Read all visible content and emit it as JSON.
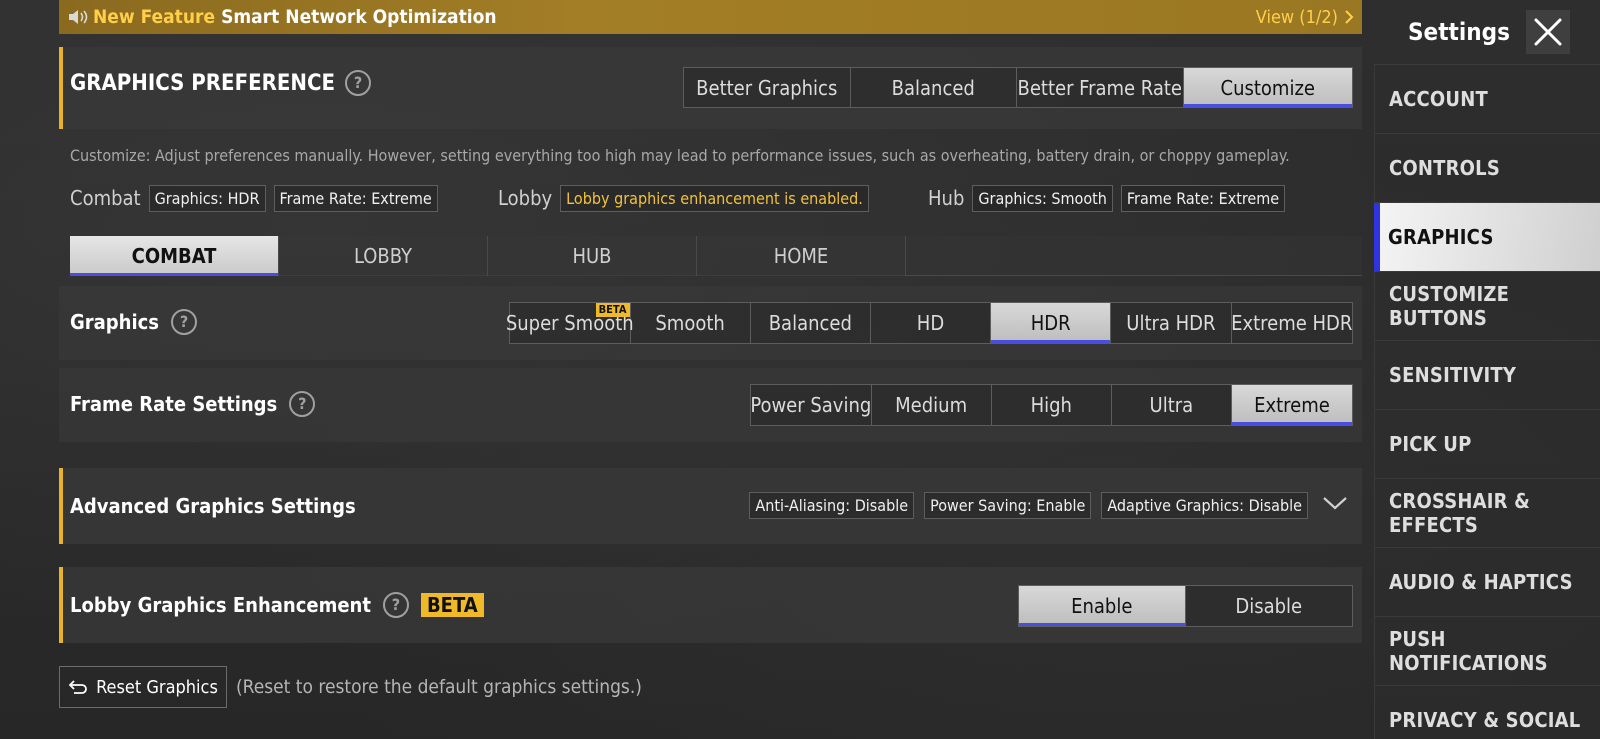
{
  "banner": {
    "new_feature": "New Feature",
    "title": "Smart Network Optimization",
    "view": "View (1/2)"
  },
  "preference": {
    "title": "GRAPHICS PREFERENCE",
    "options": [
      "Better Graphics",
      "Balanced",
      "Better Frame Rate",
      "Customize"
    ],
    "selected": "Customize",
    "description": "Customize: Adjust preferences manually. However, setting everything too high may lead to performance issues, such as overheating, battery drain, or choppy gameplay."
  },
  "summary": {
    "combat_label": "Combat",
    "combat_graphics": "Graphics: HDR",
    "combat_frame_rate": "Frame Rate: Extreme",
    "lobby_label": "Lobby",
    "lobby_status": "Lobby graphics enhancement is enabled.",
    "hub_label": "Hub",
    "hub_graphics": "Graphics: Smooth",
    "hub_frame_rate": "Frame Rate: Extreme"
  },
  "tabs": [
    "COMBAT",
    "LOBBY",
    "HUB",
    "HOME"
  ],
  "active_tab": "COMBAT",
  "graphics": {
    "label": "Graphics",
    "options": [
      "Super Smooth",
      "Smooth",
      "Balanced",
      "HD",
      "HDR",
      "Ultra HDR",
      "Extreme HDR"
    ],
    "beta_badge": "BETA",
    "selected": "HDR"
  },
  "frame_rate": {
    "label": "Frame Rate Settings",
    "options": [
      "Power Saving",
      "Medium",
      "High",
      "Ultra",
      "Extreme"
    ],
    "selected": "Extreme"
  },
  "advanced": {
    "label": "Advanced Graphics Settings",
    "tags": [
      "Anti-Aliasing: Disable",
      "Power Saving: Enable",
      "Adaptive Graphics: Disable"
    ]
  },
  "lobby_enhancement": {
    "label": "Lobby Graphics Enhancement",
    "beta": "BETA",
    "options": [
      "Enable",
      "Disable"
    ],
    "selected": "Enable"
  },
  "reset": {
    "button": "Reset Graphics",
    "note": "(Reset to restore the default graphics settings.)"
  },
  "sidebar": {
    "title": "Settings",
    "items": [
      "ACCOUNT",
      "CONTROLS",
      "GRAPHICS",
      "CUSTOMIZE BUTTONS",
      "SENSITIVITY",
      "PICK UP",
      "CROSSHAIR & EFFECTS",
      "AUDIO & HAPTICS",
      "PUSH NOTIFICATIONS",
      "PRIVACY & SOCIAL"
    ],
    "active": "GRAPHICS"
  },
  "colors": {
    "accent_gold": "#e8b32a",
    "selected_underline": "#4b4ce0",
    "sidebar_active_bar": "#2d34e0"
  }
}
